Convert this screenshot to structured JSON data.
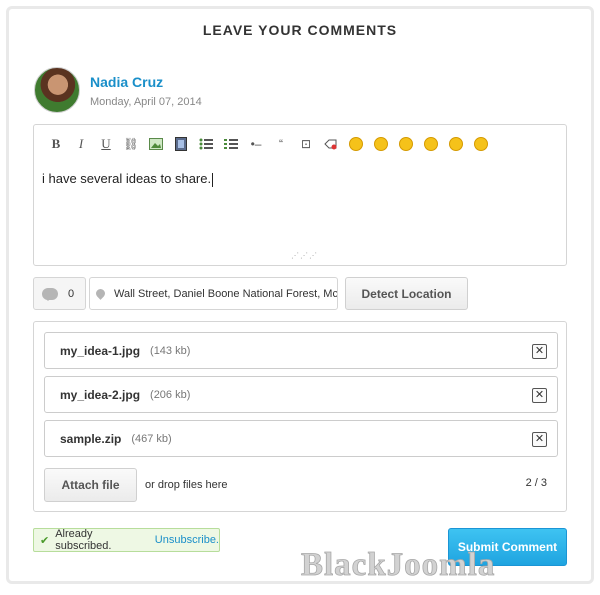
{
  "title": "LEAVE YOUR COMMENTS",
  "author": {
    "name": "Nadia Cruz",
    "date": "Monday, April 07, 2014"
  },
  "editor": {
    "toolbar": [
      {
        "icon": "bold-icon",
        "glyph": "B"
      },
      {
        "icon": "italic-icon",
        "glyph": "I"
      },
      {
        "icon": "underline-icon",
        "glyph": "U"
      },
      {
        "icon": "link-icon",
        "glyph": "⛓"
      },
      {
        "icon": "image-icon",
        "glyph": "▣"
      },
      {
        "icon": "video-icon",
        "glyph": "▤"
      },
      {
        "icon": "bullet-list-icon",
        "glyph": "☰"
      },
      {
        "icon": "numbered-list-icon",
        "glyph": "☷"
      },
      {
        "icon": "horizontal-rule-icon",
        "glyph": "•–"
      },
      {
        "icon": "quote-icon",
        "glyph": "“"
      },
      {
        "icon": "code-icon",
        "glyph": "⊡"
      },
      {
        "icon": "clear-formatting-icon",
        "glyph": "⌫"
      }
    ],
    "smiley_count": 6,
    "text": "i have several ideas to share."
  },
  "comment_count": "0",
  "location": {
    "value": "Wall Street, Daniel Boone National Forest, McK"
  },
  "detect_location_label": "Detect Location",
  "files": [
    {
      "name": "my_idea-1.jpg",
      "size": "(143 kb)"
    },
    {
      "name": "my_idea-2.jpg",
      "size": "(206 kb)"
    },
    {
      "name": "sample.zip",
      "size": "(467 kb)"
    }
  ],
  "file_remove_glyph": "✕",
  "attach_label": "Attach file",
  "drop_text": "or drop files here",
  "file_counter": "2 / 3",
  "subscription": {
    "text": "Already subscribed.",
    "link": "Unsubscribe."
  },
  "submit_label": "Submit Comment",
  "watermark": "BlackJoomla",
  "colors": {
    "link": "#1a8fc9",
    "submit": "#2bb3ea",
    "success_bg": "#eef8e4"
  }
}
